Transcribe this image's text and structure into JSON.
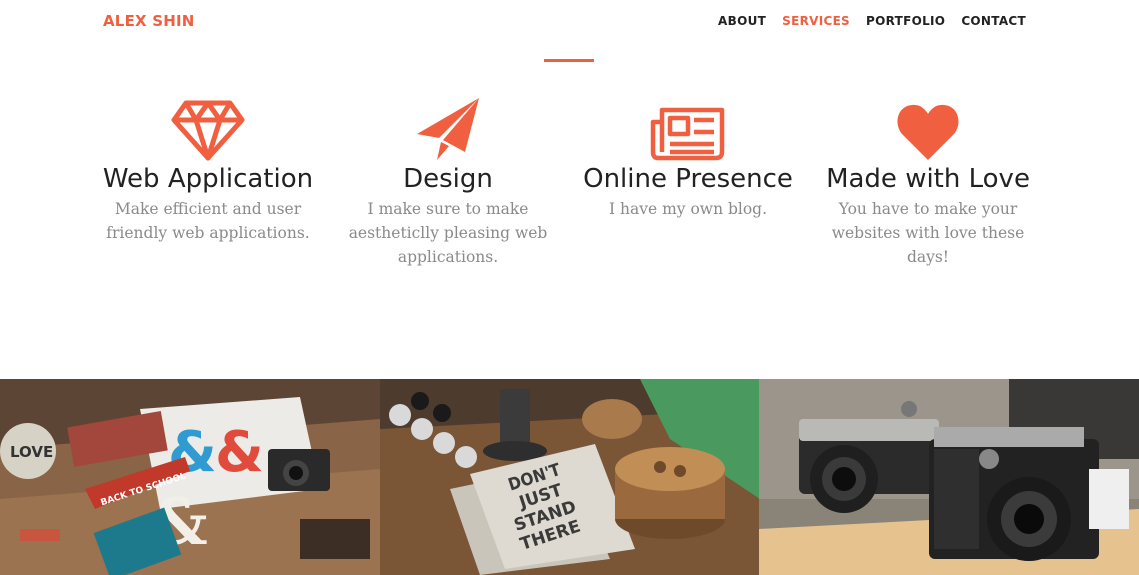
{
  "nav": {
    "brand": "ALEX SHIN",
    "items": [
      {
        "label": "ABOUT",
        "active": false
      },
      {
        "label": "SERVICES",
        "active": true
      },
      {
        "label": "PORTFOLIO",
        "active": false
      },
      {
        "label": "CONTACT",
        "active": false
      }
    ]
  },
  "colors": {
    "accent": "#f05f40",
    "heading": "#222222",
    "muted": "#8a8a8a"
  },
  "services": [
    {
      "icon": "diamond-icon",
      "title": "Web Application",
      "text": "Make efficient and user friendly web applications."
    },
    {
      "icon": "paper-plane-icon",
      "title": "Design",
      "text": "I make sure to make aestheticlly pleasing web applications."
    },
    {
      "icon": "newspaper-icon",
      "title": "Online Presence",
      "text": "I have my own blog."
    },
    {
      "icon": "heart-icon",
      "title": "Made with Love",
      "text": "You have to make your websites with love these days!"
    }
  ],
  "portfolio": {
    "images": [
      {
        "subject": "flat-lay-design-items"
      },
      {
        "subject": "notebooks-and-coasters"
      },
      {
        "subject": "vintage-cameras"
      }
    ],
    "texts": {
      "badge_love": "LOVE",
      "pennant": "BACK TO SCHOOL",
      "notebook_line1": "DON'T",
      "notebook_line2": "JUST",
      "notebook_line3": "STAND",
      "notebook_line4": "THERE"
    }
  }
}
